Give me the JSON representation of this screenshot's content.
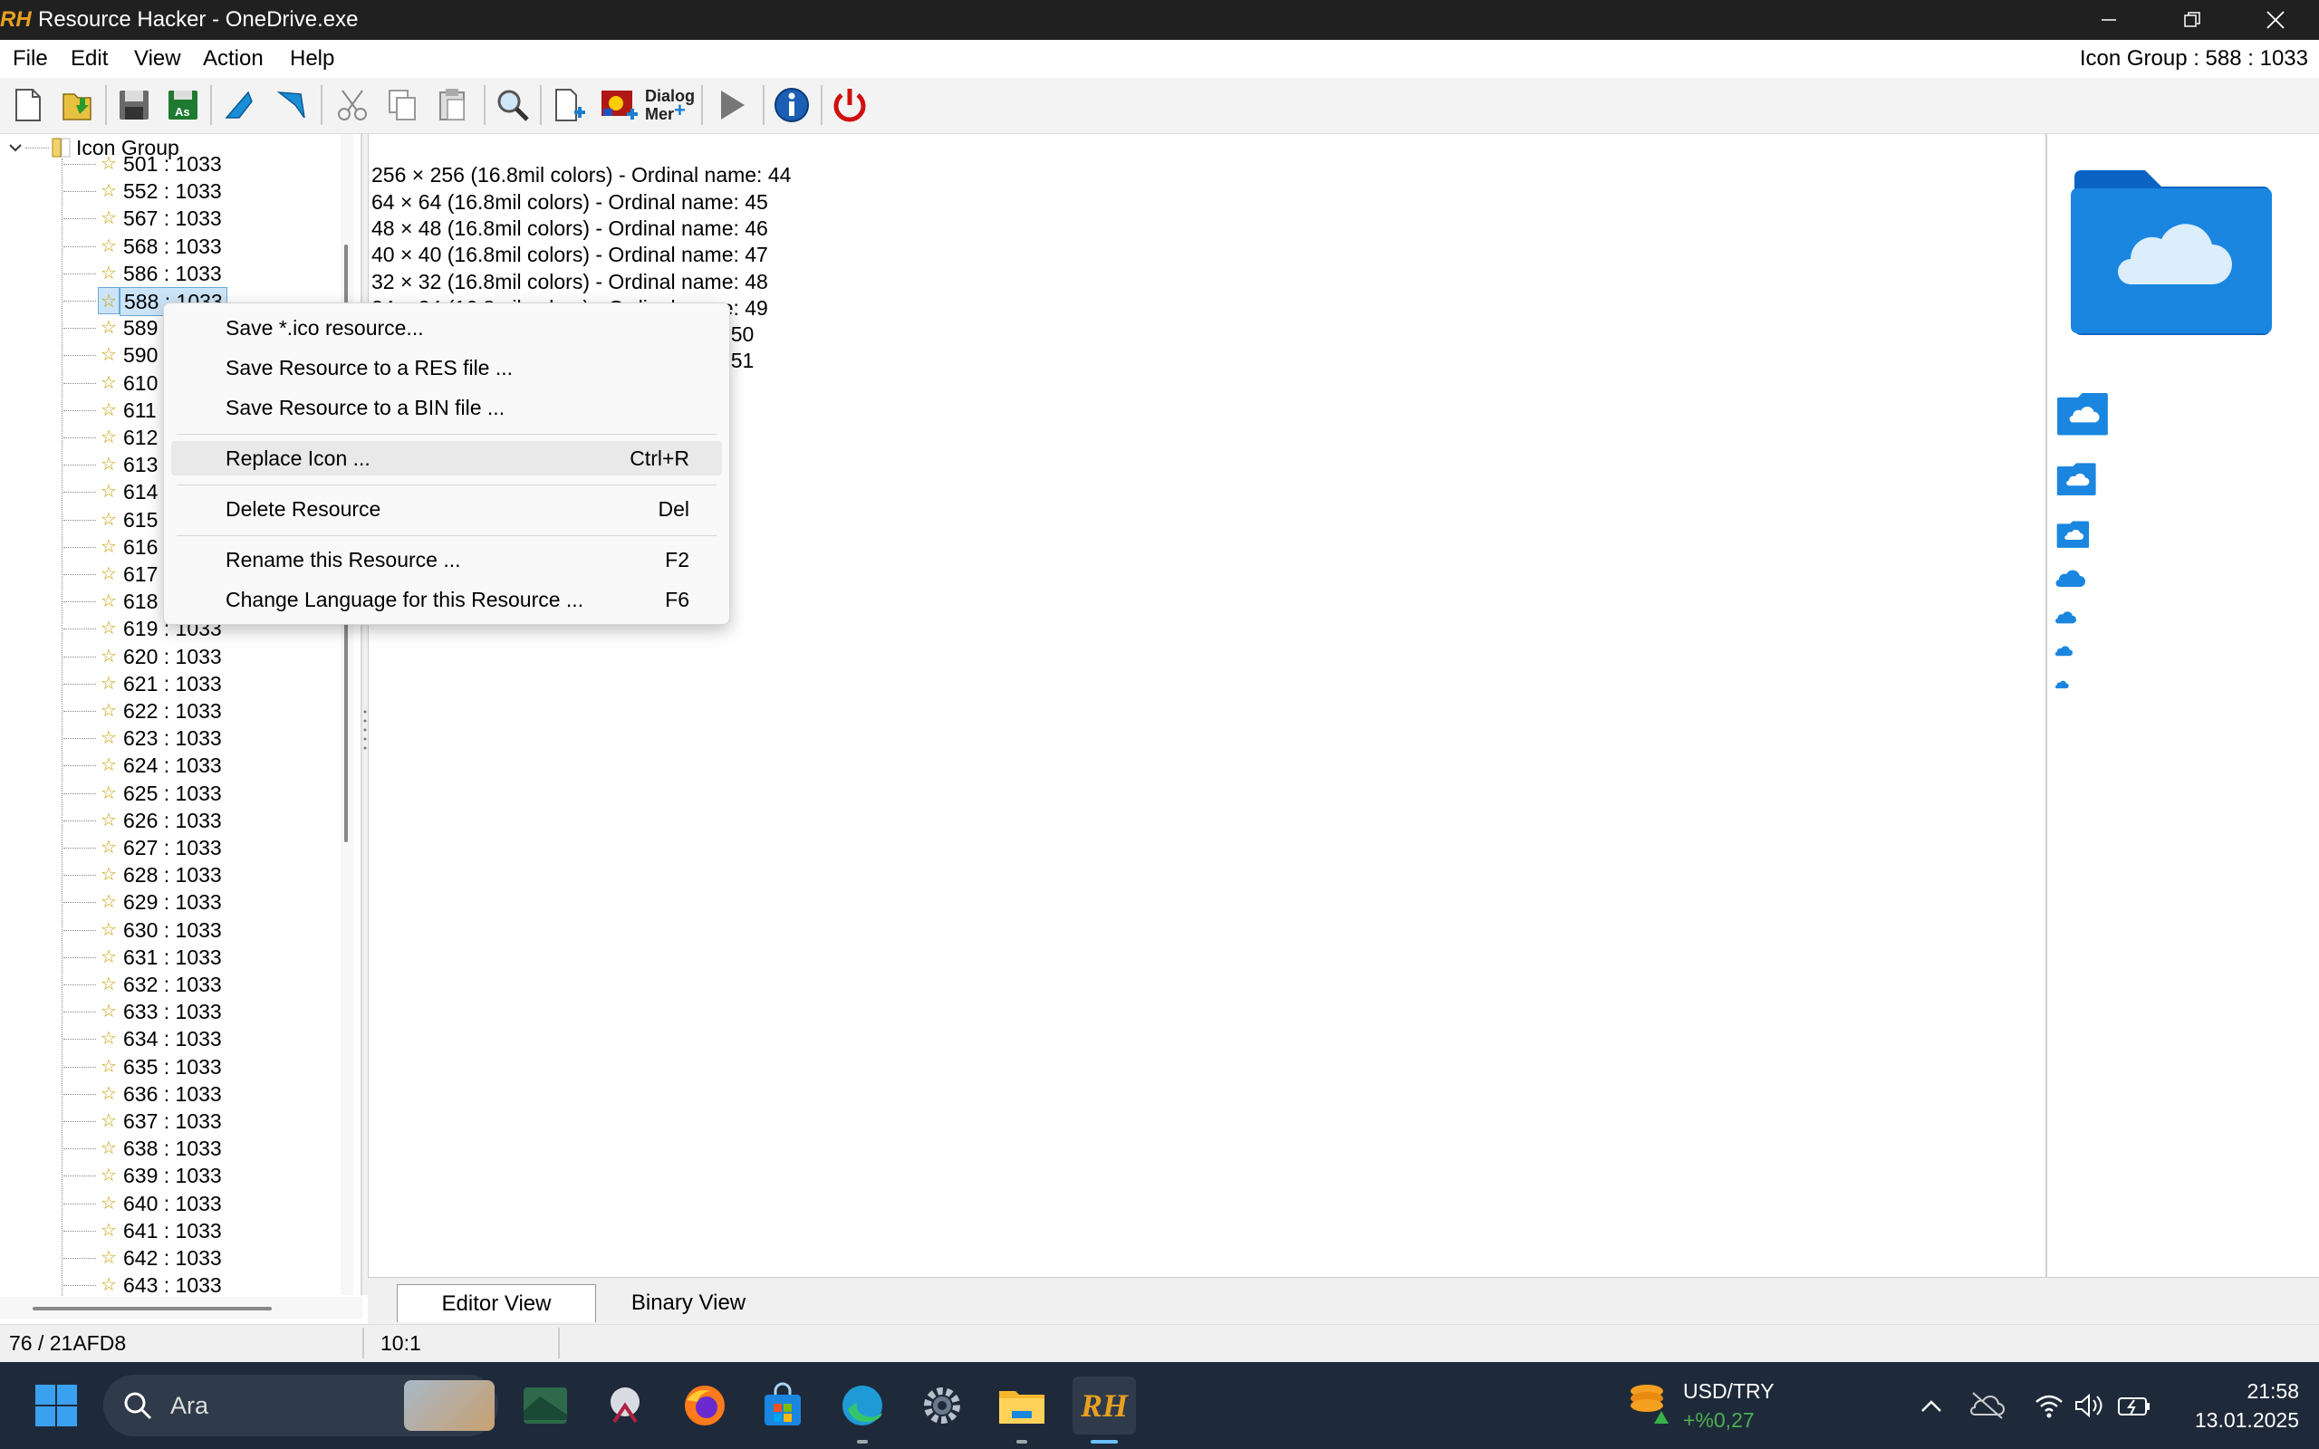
{
  "window": {
    "title": "Resource Hacker - OneDrive.exe",
    "logo": "RH",
    "controls": [
      "minimize-icon",
      "restore-icon",
      "close-icon"
    ]
  },
  "menu": {
    "items": [
      "File",
      "Edit",
      "View",
      "Action",
      "Help"
    ],
    "status": "Icon Group : 588 : 1033"
  },
  "toolbar": {
    "dialog_label_1": "Dialog",
    "dialog_label_2": "Mer",
    "icons": [
      "new-file-icon",
      "open-file-icon",
      "save-icon",
      "save-as-icon",
      "back-icon",
      "forward-icon",
      "cut-icon",
      "copy-icon",
      "paste-icon",
      "find-icon",
      "add-resource-icon",
      "add-image-icon",
      "dialog-merger-icon",
      "run-script-icon",
      "info-icon",
      "power-icon"
    ]
  },
  "tree": {
    "root_label": "Icon Group",
    "items": [
      "501 : 1033",
      "552 : 1033",
      "567 : 1033",
      "568 : 1033",
      "586 : 1033",
      "588 : 1033",
      "589",
      "590",
      "610",
      "611",
      "612",
      "613",
      "614",
      "615",
      "616",
      "617",
      "618",
      "619 : 1033",
      "620 : 1033",
      "621 : 1033",
      "622 : 1033",
      "623 : 1033",
      "624 : 1033",
      "625 : 1033",
      "626 : 1033",
      "627 : 1033",
      "628 : 1033",
      "629 : 1033",
      "630 : 1033",
      "631 : 1033",
      "632 : 1033",
      "633 : 1033",
      "634 : 1033",
      "635 : 1033",
      "636 : 1033",
      "637 : 1033",
      "638 : 1033",
      "639 : 1033",
      "640 : 1033",
      "641 : 1033",
      "642 : 1033",
      "643 : 1033"
    ],
    "selected_index": 5
  },
  "editor": {
    "lines": [
      "256 × 256 (16.8mil colors) - Ordinal name: 44",
      "64 × 64 (16.8mil colors) - Ordinal name: 45",
      "48 × 48 (16.8mil colors) - Ordinal name: 46",
      "40 × 40 (16.8mil colors) - Ordinal name: 47",
      "32 × 32 (16.8mil colors) - Ordinal name: 48",
      "24 × 24 (16.8mil colors) - Ordinal name: 49",
      "me: 50",
      "me: 51"
    ]
  },
  "context_menu": {
    "items": [
      {
        "label": "Save *.ico resource...",
        "shortcut": ""
      },
      {
        "label": "Save Resource to a RES file ...",
        "shortcut": ""
      },
      {
        "label": "Save Resource to a BIN file ...",
        "shortcut": ""
      },
      {
        "label": "Replace Icon ...",
        "shortcut": "Ctrl+R"
      },
      {
        "label": "Delete Resource",
        "shortcut": "Del"
      },
      {
        "label": "Rename this Resource ...",
        "shortcut": "F2"
      },
      {
        "label": "Change Language for this Resource ...",
        "shortcut": "F6"
      }
    ]
  },
  "tabs": [
    "Editor View",
    "Binary View"
  ],
  "statusbar": {
    "left": "76 / 21AFD8",
    "position": "10:1"
  },
  "taskbar": {
    "search_placeholder": "Ara",
    "widget_title": "USD/TRY",
    "widget_value": "+%0,27",
    "time": "21:58",
    "date": "13.01.2025",
    "colors": {
      "widget_value": "#4caf50",
      "accent": "#0078d4"
    }
  }
}
